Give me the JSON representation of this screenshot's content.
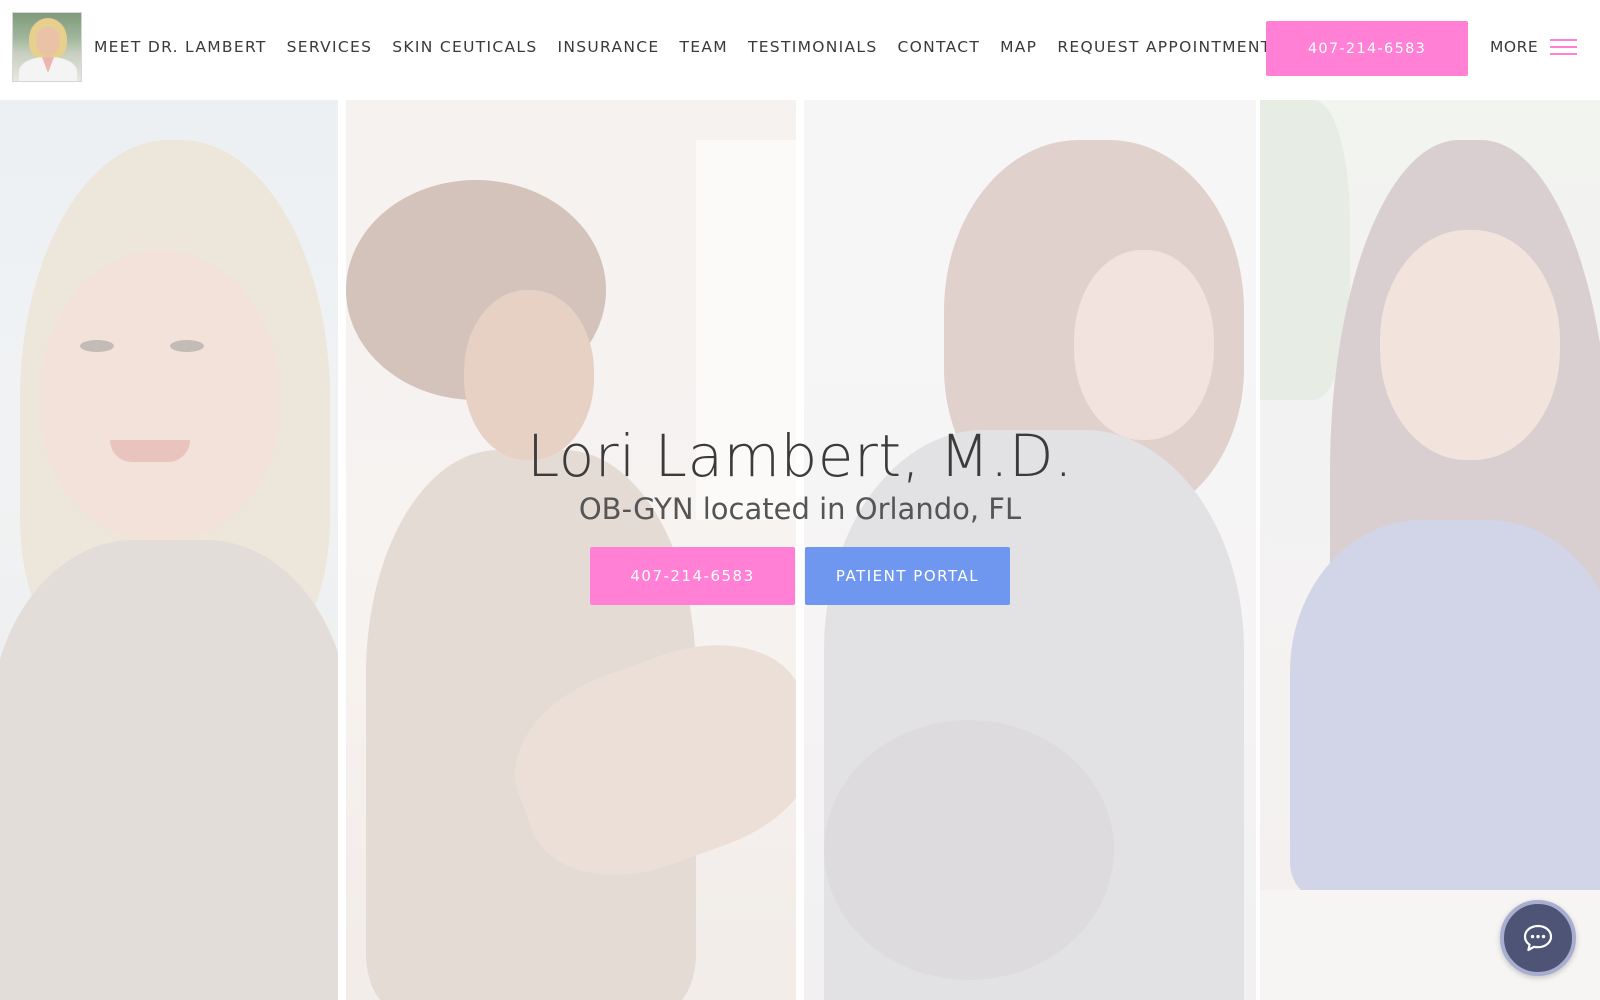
{
  "header": {
    "logo_alt": "Dr. Lori Lambert photo",
    "nav": [
      {
        "label": "MEET DR. LAMBERT"
      },
      {
        "label": "SERVICES"
      },
      {
        "label": "SKIN CEUTICALS"
      },
      {
        "label": "INSURANCE"
      },
      {
        "label": "TEAM"
      },
      {
        "label": "TESTIMONIALS"
      },
      {
        "label": "CONTACT"
      },
      {
        "label": "MAP"
      },
      {
        "label": "REQUEST APPOINTMENT"
      }
    ],
    "phone_button": "407-214-6583",
    "more_label": "MORE",
    "menu_icon": "hamburger-icon"
  },
  "hero": {
    "title": "Lori Lambert, M.D.",
    "subtitle": "OB-GYN located in Orlando, FL",
    "phone_button": "407-214-6583",
    "portal_button": "PATIENT PORTAL"
  },
  "chat": {
    "icon": "chat-bubble-icon"
  },
  "colors": {
    "accent_pink": "#ff80d5",
    "accent_blue": "#6f97f0",
    "chat_bg": "#4d5475"
  }
}
